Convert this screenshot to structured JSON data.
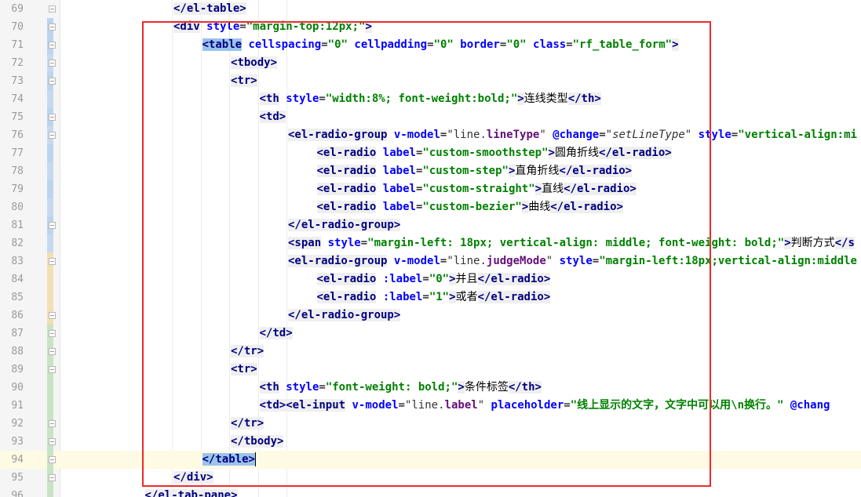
{
  "editor": {
    "first_line_number": 69,
    "current_line_number": 94,
    "lines": [
      {
        "n": "69",
        "indent": 4,
        "tokens": [
          {
            "t": "</el-table>",
            "c": "tg"
          }
        ]
      },
      {
        "n": "70",
        "indent": 4,
        "tokens": [
          {
            "t": "<div",
            "c": "tg"
          },
          {
            "t": " style",
            "c": "at"
          },
          {
            "t": "=",
            "c": "pt"
          },
          {
            "t": "\"margin-top:12px;\"",
            "c": "vl"
          },
          {
            "t": ">",
            "c": "tg"
          }
        ]
      },
      {
        "n": "71",
        "indent": 5,
        "tokens": [
          {
            "t": "<table",
            "c": "tg hl"
          },
          {
            "t": " cellspacing",
            "c": "at"
          },
          {
            "t": "=",
            "c": "pt"
          },
          {
            "t": "\"0\"",
            "c": "vl"
          },
          {
            "t": " cellpadding",
            "c": "at"
          },
          {
            "t": "=",
            "c": "pt"
          },
          {
            "t": "\"0\"",
            "c": "vl"
          },
          {
            "t": " border",
            "c": "at"
          },
          {
            "t": "=",
            "c": "pt"
          },
          {
            "t": "\"0\"",
            "c": "vl"
          },
          {
            "t": " class",
            "c": "at"
          },
          {
            "t": "=",
            "c": "pt"
          },
          {
            "t": "\"rf_table_form\"",
            "c": "vl"
          },
          {
            "t": ">",
            "c": "tg"
          }
        ]
      },
      {
        "n": "72",
        "indent": 6,
        "tokens": [
          {
            "t": "<tbody>",
            "c": "tg"
          }
        ]
      },
      {
        "n": "73",
        "indent": 6,
        "tokens": [
          {
            "t": "<tr>",
            "c": "tg"
          }
        ]
      },
      {
        "n": "74",
        "indent": 7,
        "tokens": [
          {
            "t": "<th",
            "c": "tg"
          },
          {
            "t": " style",
            "c": "at"
          },
          {
            "t": "=",
            "c": "pt"
          },
          {
            "t": "\"width:8%; font-weight:bold;\"",
            "c": "vl"
          },
          {
            "t": ">",
            "c": "tg"
          },
          {
            "t": "连线类型",
            "c": "tx"
          },
          {
            "t": "</th>",
            "c": "tg"
          }
        ]
      },
      {
        "n": "75",
        "indent": 7,
        "tokens": [
          {
            "t": "<td>",
            "c": "tg"
          }
        ]
      },
      {
        "n": "76",
        "indent": 8,
        "tokens": [
          {
            "t": "<el-radio-group",
            "c": "tg"
          },
          {
            "t": " v-model",
            "c": "at"
          },
          {
            "t": "=",
            "c": "pt"
          },
          {
            "t": "\"line.",
            "c": "vl plain"
          },
          {
            "t": "lineType",
            "c": "vl prop"
          },
          {
            "t": "\"",
            "c": "vl plain"
          },
          {
            "t": " @change",
            "c": "at"
          },
          {
            "t": "=",
            "c": "pt"
          },
          {
            "t": "\"setLineType\"",
            "c": "vl fn"
          },
          {
            "t": " style",
            "c": "at"
          },
          {
            "t": "=",
            "c": "pt"
          },
          {
            "t": "\"vertical-align:mi",
            "c": "vl"
          }
        ]
      },
      {
        "n": "77",
        "indent": 9,
        "tokens": [
          {
            "t": "<el-radio",
            "c": "tg"
          },
          {
            "t": " label",
            "c": "at"
          },
          {
            "t": "=",
            "c": "pt"
          },
          {
            "t": "\"custom-smoothstep\"",
            "c": "vl"
          },
          {
            "t": ">",
            "c": "tg"
          },
          {
            "t": "圆角折线",
            "c": "tx"
          },
          {
            "t": "</el-radio>",
            "c": "tg"
          }
        ]
      },
      {
        "n": "78",
        "indent": 9,
        "tokens": [
          {
            "t": "<el-radio",
            "c": "tg"
          },
          {
            "t": " label",
            "c": "at"
          },
          {
            "t": "=",
            "c": "pt"
          },
          {
            "t": "\"custom-step\"",
            "c": "vl"
          },
          {
            "t": ">",
            "c": "tg"
          },
          {
            "t": "直角折线",
            "c": "tx"
          },
          {
            "t": "</el-radio>",
            "c": "tg"
          }
        ]
      },
      {
        "n": "79",
        "indent": 9,
        "tokens": [
          {
            "t": "<el-radio",
            "c": "tg"
          },
          {
            "t": " label",
            "c": "at"
          },
          {
            "t": "=",
            "c": "pt"
          },
          {
            "t": "\"custom-straight\"",
            "c": "vl"
          },
          {
            "t": ">",
            "c": "tg"
          },
          {
            "t": "直线",
            "c": "tx"
          },
          {
            "t": "</el-radio>",
            "c": "tg"
          }
        ]
      },
      {
        "n": "80",
        "indent": 9,
        "tokens": [
          {
            "t": "<el-radio",
            "c": "tg"
          },
          {
            "t": " label",
            "c": "at"
          },
          {
            "t": "=",
            "c": "pt"
          },
          {
            "t": "\"custom-bezier\"",
            "c": "vl"
          },
          {
            "t": ">",
            "c": "tg"
          },
          {
            "t": "曲线",
            "c": "tx"
          },
          {
            "t": "</el-radio>",
            "c": "tg"
          }
        ]
      },
      {
        "n": "81",
        "indent": 8,
        "tokens": [
          {
            "t": "</el-radio-group>",
            "c": "tg"
          }
        ]
      },
      {
        "n": "82",
        "indent": 8,
        "tokens": [
          {
            "t": "<span",
            "c": "tg"
          },
          {
            "t": " style",
            "c": "at"
          },
          {
            "t": "=",
            "c": "pt"
          },
          {
            "t": "\"margin-left: 18px; vertical-align: middle; font-weight: bold;\"",
            "c": "vl"
          },
          {
            "t": ">",
            "c": "tg"
          },
          {
            "t": "判断方式",
            "c": "tx"
          },
          {
            "t": "</s",
            "c": "tg"
          }
        ]
      },
      {
        "n": "83",
        "indent": 8,
        "tokens": [
          {
            "t": "<el-radio-group",
            "c": "tg"
          },
          {
            "t": " v-model",
            "c": "at"
          },
          {
            "t": "=",
            "c": "pt"
          },
          {
            "t": "\"line.",
            "c": "vl plain"
          },
          {
            "t": "judgeMode",
            "c": "vl prop"
          },
          {
            "t": "\"",
            "c": "vl plain"
          },
          {
            "t": " style",
            "c": "at"
          },
          {
            "t": "=",
            "c": "pt"
          },
          {
            "t": "\"margin-left:18px;vertical-align:middle",
            "c": "vl"
          }
        ]
      },
      {
        "n": "84",
        "indent": 9,
        "tokens": [
          {
            "t": "<el-radio",
            "c": "tg"
          },
          {
            "t": " :label",
            "c": "at"
          },
          {
            "t": "=",
            "c": "pt"
          },
          {
            "t": "\"0\"",
            "c": "vl"
          },
          {
            "t": ">",
            "c": "tg"
          },
          {
            "t": "并且",
            "c": "tx"
          },
          {
            "t": "</el-radio>",
            "c": "tg"
          }
        ]
      },
      {
        "n": "85",
        "indent": 9,
        "tokens": [
          {
            "t": "<el-radio",
            "c": "tg"
          },
          {
            "t": " :label",
            "c": "at"
          },
          {
            "t": "=",
            "c": "pt"
          },
          {
            "t": "\"1\"",
            "c": "vl"
          },
          {
            "t": ">",
            "c": "tg"
          },
          {
            "t": "或者",
            "c": "tx"
          },
          {
            "t": "</el-radio>",
            "c": "tg"
          }
        ]
      },
      {
        "n": "86",
        "indent": 8,
        "tokens": [
          {
            "t": "</el-radio-group>",
            "c": "tg"
          }
        ]
      },
      {
        "n": "87",
        "indent": 7,
        "tokens": [
          {
            "t": "</td>",
            "c": "tg"
          }
        ]
      },
      {
        "n": "88",
        "indent": 6,
        "tokens": [
          {
            "t": "</tr>",
            "c": "tg"
          }
        ]
      },
      {
        "n": "89",
        "indent": 6,
        "tokens": [
          {
            "t": "<tr>",
            "c": "tg"
          }
        ]
      },
      {
        "n": "90",
        "indent": 7,
        "tokens": [
          {
            "t": "<th",
            "c": "tg"
          },
          {
            "t": " style",
            "c": "at"
          },
          {
            "t": "=",
            "c": "pt"
          },
          {
            "t": "\"font-weight: bold;\"",
            "c": "vl"
          },
          {
            "t": ">",
            "c": "tg"
          },
          {
            "t": "条件标签",
            "c": "tx"
          },
          {
            "t": "</th>",
            "c": "tg"
          }
        ]
      },
      {
        "n": "91",
        "indent": 7,
        "tokens": [
          {
            "t": "<td>",
            "c": "tg"
          },
          {
            "t": "<el-input",
            "c": "tg"
          },
          {
            "t": " v-model",
            "c": "at"
          },
          {
            "t": "=",
            "c": "pt"
          },
          {
            "t": "\"line.",
            "c": "vl plain"
          },
          {
            "t": "label",
            "c": "vl prop"
          },
          {
            "t": "\"",
            "c": "vl plain"
          },
          {
            "t": " placeholder",
            "c": "at"
          },
          {
            "t": "=",
            "c": "pt"
          },
          {
            "t": "\"线上显示的文字，文字中可以用\\n换行。\"",
            "c": "vl"
          },
          {
            "t": " @chang",
            "c": "at"
          }
        ]
      },
      {
        "n": "92",
        "indent": 6,
        "tokens": [
          {
            "t": "</tr>",
            "c": "tg"
          }
        ]
      },
      {
        "n": "93",
        "indent": 6,
        "tokens": [
          {
            "t": "</tbody>",
            "c": "tg"
          }
        ]
      },
      {
        "n": "94",
        "indent": 5,
        "tokens": [
          {
            "t": "</table>",
            "c": "tg hl"
          }
        ]
      },
      {
        "n": "95",
        "indent": 4,
        "tokens": [
          {
            "t": "</div>",
            "c": "tg"
          }
        ]
      },
      {
        "n": "96",
        "indent": 3,
        "tokens": [
          {
            "t": "</el-tab-pane>",
            "c": "tg"
          }
        ]
      }
    ]
  },
  "colors": {
    "selection_box": "#ee2a2a",
    "tag": "#000080",
    "attribute": "#0000ff",
    "value": "#008000",
    "current_line": "#fffae3"
  }
}
